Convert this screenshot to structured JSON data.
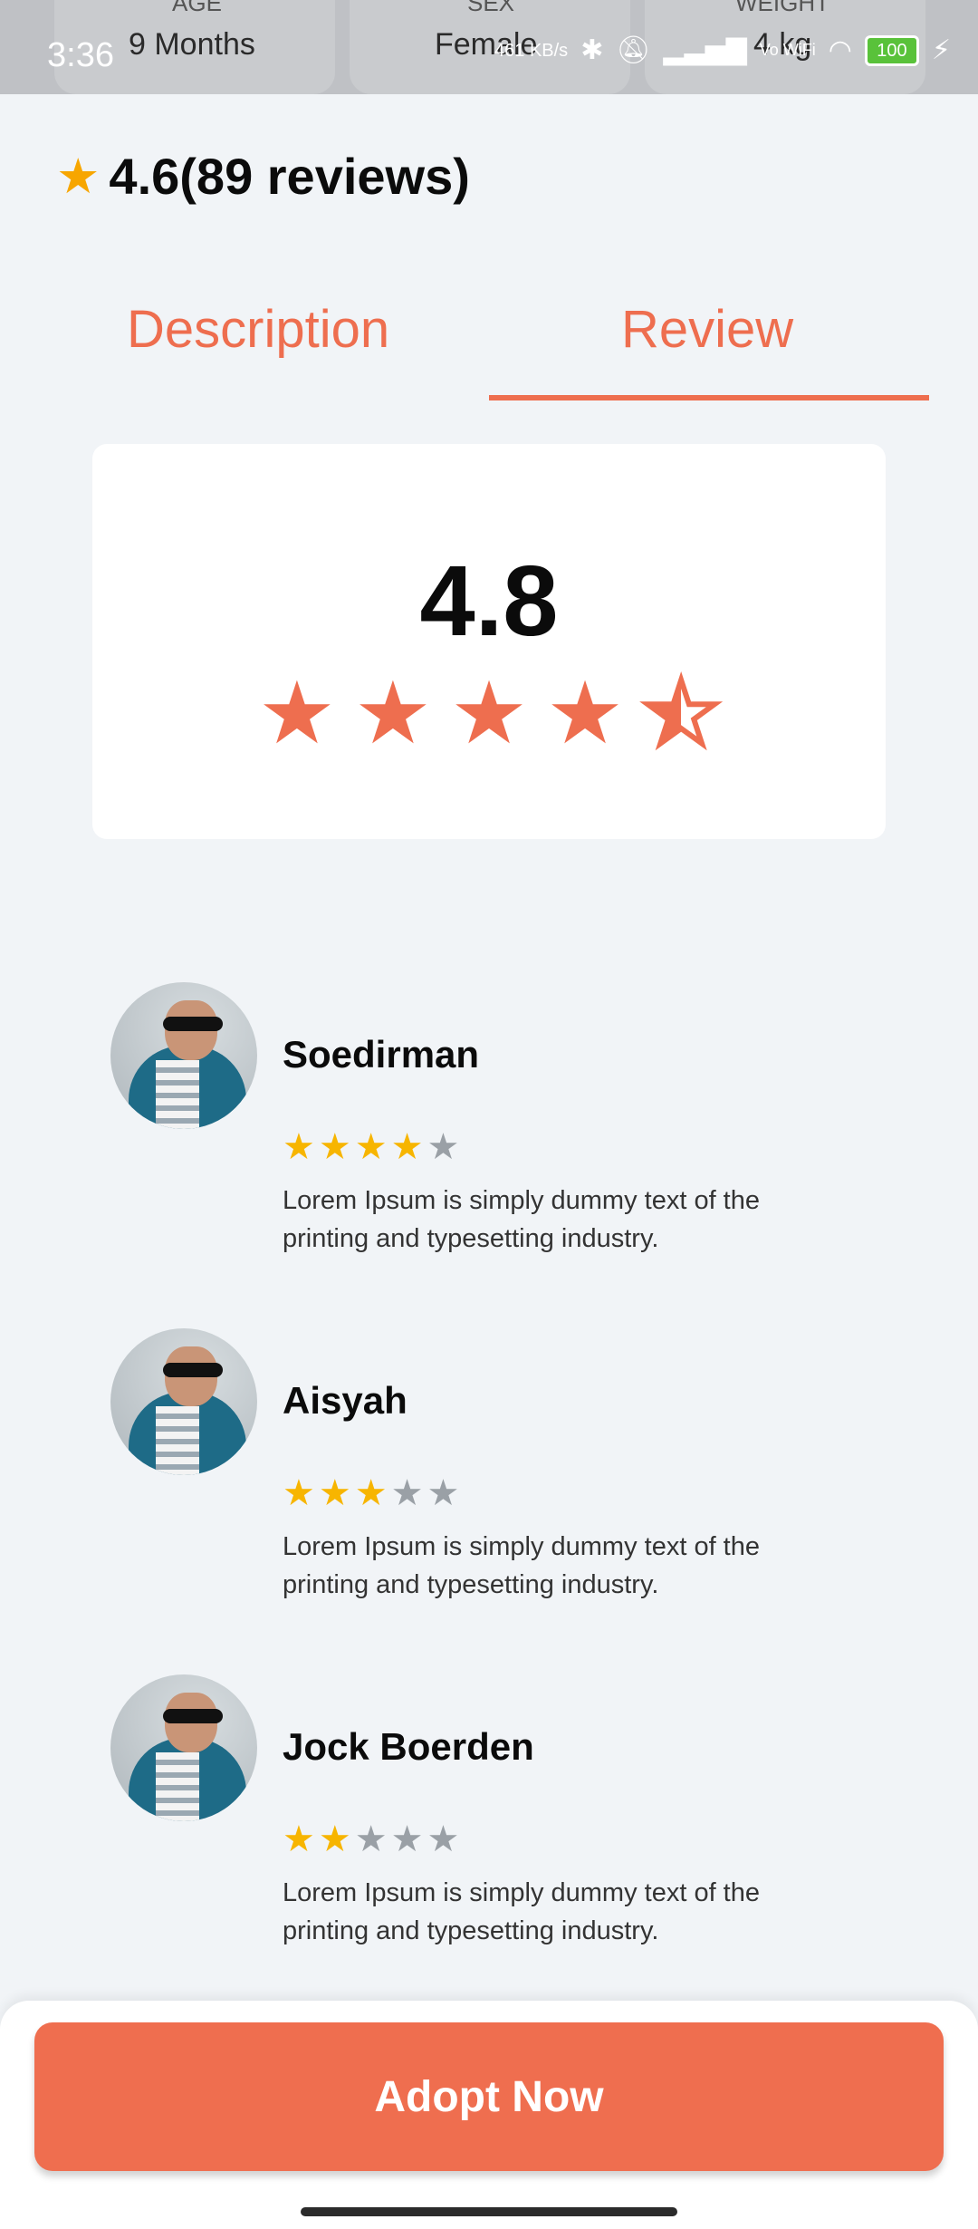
{
  "status_bar": {
    "time": "3:36",
    "net_speed": "461 KB/s",
    "battery": "100",
    "network": "Vo WiFi"
  },
  "header_strip": {
    "age_label": "AGE",
    "age_value": "9 Months",
    "sex_label": "SEX",
    "sex_value": "Female",
    "weight_label": "WEIGHT",
    "weight_value": "4 kg"
  },
  "rating": {
    "text": "4.6(89 reviews)"
  },
  "tabs": {
    "description": "Description",
    "review": "Review",
    "active": "review"
  },
  "summary": {
    "score": "4.8",
    "stars": 4.5
  },
  "reviews": [
    {
      "name": "Soedirman",
      "stars": 4,
      "text": "Lorem Ipsum is simply dummy text of the printing and typesetting industry."
    },
    {
      "name": "Aisyah",
      "stars": 3,
      "text": "Lorem Ipsum is simply dummy text of the printing and typesetting industry."
    },
    {
      "name": "Jock Boerden",
      "stars": 2,
      "text": "Lorem Ipsum is simply dummy text of the printing and typesetting industry."
    }
  ],
  "cta": {
    "label": "Adopt Now"
  },
  "colors": {
    "accent": "#EF6E4F",
    "star_gold": "#F7B500",
    "star_gray": "#9AA0A6",
    "background": "#F1F4F7"
  }
}
